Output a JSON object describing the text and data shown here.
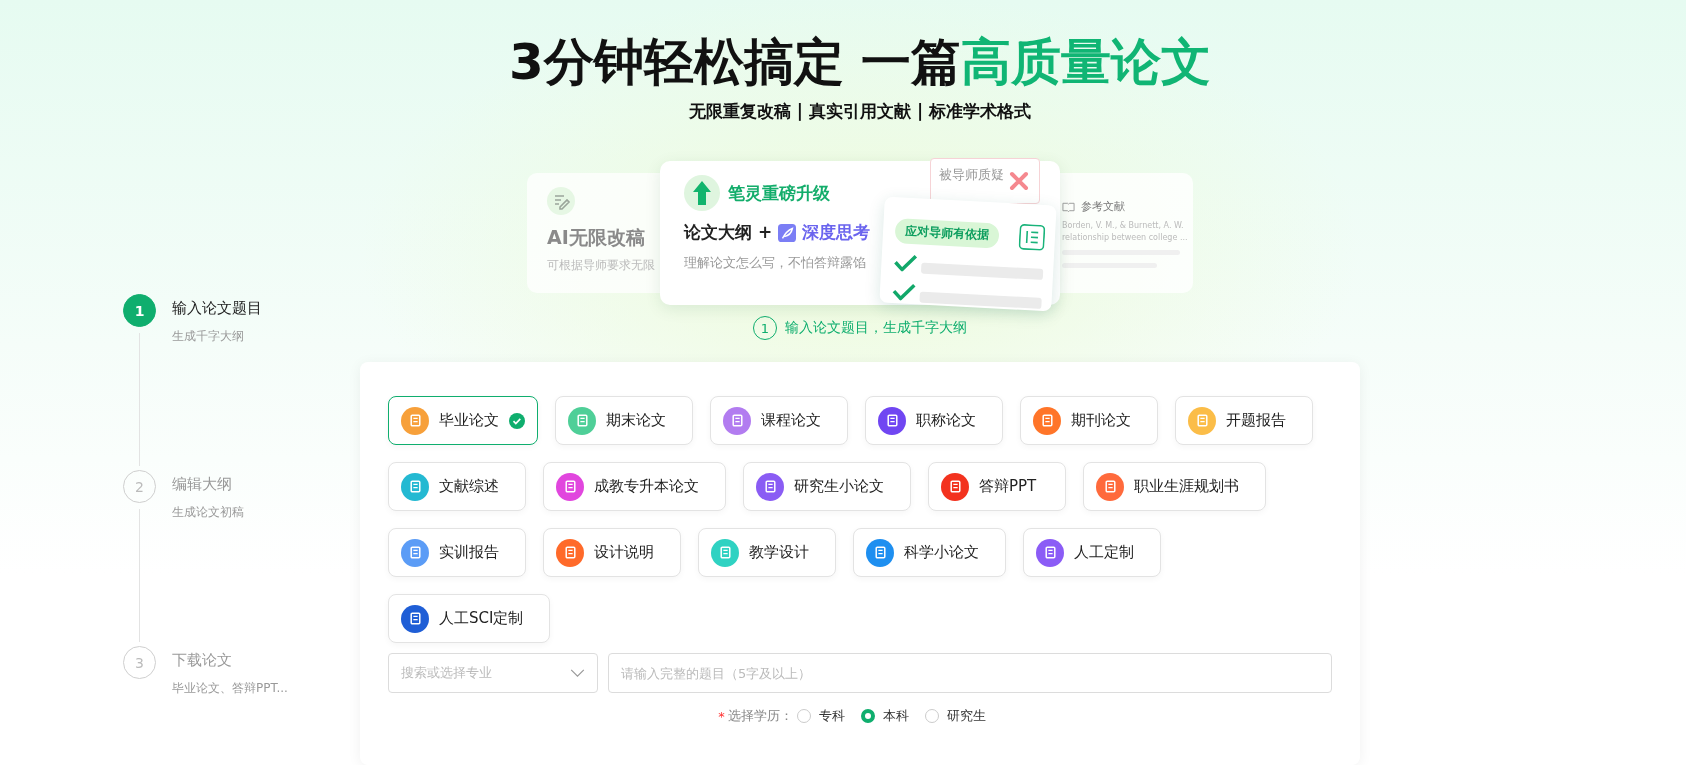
{
  "hero": {
    "title_plain": "3分钟轻松搞定 一篇",
    "title_highlight": "高质量论文",
    "subtitle": "无限重复改稿 | 真实引用文献 | 标准学术格式"
  },
  "banner": {
    "left_card": {
      "title": "AI无限改稿",
      "text": "可根据导师要求无限"
    },
    "main_card": {
      "brand": "笔灵重磅升级",
      "headline": "论文大纲 +",
      "badge": "深度思考",
      "text": "理解论文怎么写，不怕答辩露馅"
    },
    "doubt_note": "被导师质疑",
    "evidence_tag": "应对导师有依据",
    "reference_card": {
      "title": "参考文献",
      "lines": [
        "Borden, V. M., & Burnett, A. W.",
        "relationship between college ..."
      ]
    }
  },
  "steps": [
    {
      "number": "1",
      "title": "输入论文题目",
      "subtitle": "生成千字大纲",
      "selected": true
    },
    {
      "number": "2",
      "title": "编辑大纲",
      "subtitle": "生成论文初稿",
      "selected": false
    },
    {
      "number": "3",
      "title": "下载论文",
      "subtitle": "毕业论文、答辩PPT...",
      "selected": false
    }
  ],
  "current_step": {
    "number": "1",
    "text": "输入论文题目，生成千字大纲"
  },
  "paper_type_rows": [
    [
      {
        "label": "毕业论文",
        "color": "#f7a03a",
        "selected": true
      },
      {
        "label": "期末论文",
        "color": "#4fcf98",
        "selected": false
      },
      {
        "label": "课程论文",
        "color": "#b27cf0",
        "selected": false
      },
      {
        "label": "职称论文",
        "color": "#7046f2",
        "selected": false
      },
      {
        "label": "期刊论文",
        "color": "#ff7529",
        "selected": false
      },
      {
        "label": "开题报告",
        "color": "#fbbd48",
        "selected": false
      }
    ],
    [
      {
        "label": "文献综述",
        "color": "#24b9d2",
        "selected": false
      },
      {
        "label": "成教专升本论文",
        "color": "#e146de",
        "selected": false
      },
      {
        "label": "研究生小论文",
        "color": "#8a5cf4",
        "selected": false
      },
      {
        "label": "答辩PPT",
        "color": "#f3321e",
        "selected": false
      },
      {
        "label": "职业生涯规划书",
        "color": "#ff6a3c",
        "selected": false
      }
    ],
    [
      {
        "label": "实训报告",
        "color": "#5b9cf6",
        "selected": false
      },
      {
        "label": "设计说明",
        "color": "#ff6a2a",
        "selected": false
      },
      {
        "label": "教学设计",
        "color": "#2fd2c2",
        "selected": false
      },
      {
        "label": "科学小论文",
        "color": "#1e8ff0",
        "selected": false
      },
      {
        "label": "人工定制",
        "color": "#8b5cf6",
        "selected": false
      }
    ],
    [
      {
        "label": "人工SCI定制",
        "color": "#1f5ed6",
        "selected": false
      }
    ]
  ],
  "major_select": {
    "placeholder": "搜索或选择专业"
  },
  "title_input": {
    "placeholder": "请输入完整的题目（5字及以上）"
  },
  "education": {
    "required_mark": "*",
    "label": "选择学历：",
    "options": [
      {
        "label": "专科",
        "selected": false
      },
      {
        "label": "本科",
        "selected": true
      },
      {
        "label": "研究生",
        "selected": false
      }
    ]
  }
}
